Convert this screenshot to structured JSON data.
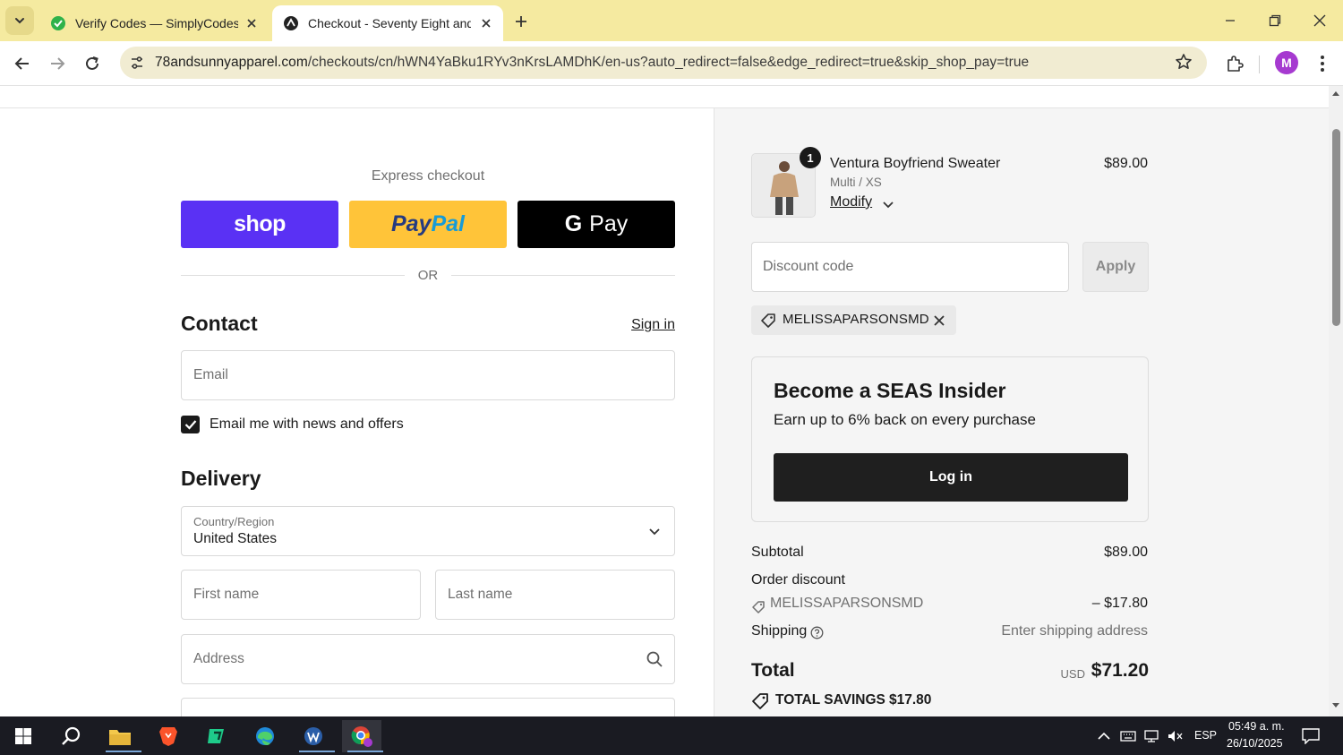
{
  "browser": {
    "tabs": [
      {
        "title": "Verify Codes — SimplyCodes",
        "active": false
      },
      {
        "title": "Checkout - Seventy Eight and S",
        "active": true
      }
    ],
    "url_host": "78andsunnyapparel.com",
    "url_path": "/checkouts/cn/hWN4YaBku1RYv3nKrsLAMDhK/en-us?auto_redirect=false&edge_redirect=true&skip_shop_pay=true",
    "profile_initial": "M",
    "colors": {
      "tabbar": "#f5eaa0",
      "omnibox": "#f1ecd2",
      "avatar": "#a63ad0"
    }
  },
  "checkout": {
    "express_checkout_title": "Express checkout",
    "express_buttons": {
      "shop": "shop",
      "paypal_part1": "Pay",
      "paypal_part2": "Pal",
      "gpay_g": "G",
      "gpay_text": "Pay"
    },
    "or_text": "OR",
    "contact": {
      "title": "Contact",
      "sign_in": "Sign in",
      "email_placeholder": "Email",
      "newsletter_label": "Email me with news and offers",
      "newsletter_checked": true
    },
    "delivery": {
      "title": "Delivery",
      "country_label": "Country/Region",
      "country_value": "United States",
      "first_name_placeholder": "First name",
      "last_name_placeholder": "Last name",
      "address_placeholder": "Address"
    },
    "colors": {
      "shop": "#5a31f4",
      "paypal": "#ffc439",
      "gpay": "#000000"
    }
  },
  "summary": {
    "product": {
      "quantity": "1",
      "name": "Ventura Boyfriend Sweater",
      "variant": "Multi / XS",
      "modify": "Modify",
      "price": "$89.00"
    },
    "discount_placeholder": "Discount code",
    "apply_label": "Apply",
    "applied_code": "MELISSAPARSONSMD",
    "insider": {
      "title": "Become a SEAS Insider",
      "subtitle": "Earn up to 6% back on every purchase",
      "login": "Log in"
    },
    "subtotal_label": "Subtotal",
    "subtotal_value": "$89.00",
    "order_discount_label": "Order discount",
    "order_discount_code": "MELISSAPARSONSMD",
    "order_discount_value": "– $17.80",
    "shipping_label": "Shipping",
    "shipping_value": "Enter shipping address",
    "total_label": "Total",
    "total_currency": "USD",
    "total_value": "$71.20",
    "savings_label": "TOTAL SAVINGS",
    "savings_value": "$17.80"
  },
  "taskbar": {
    "language": "ESP",
    "time": "05:49 a. m.",
    "date": "26/10/2025"
  }
}
